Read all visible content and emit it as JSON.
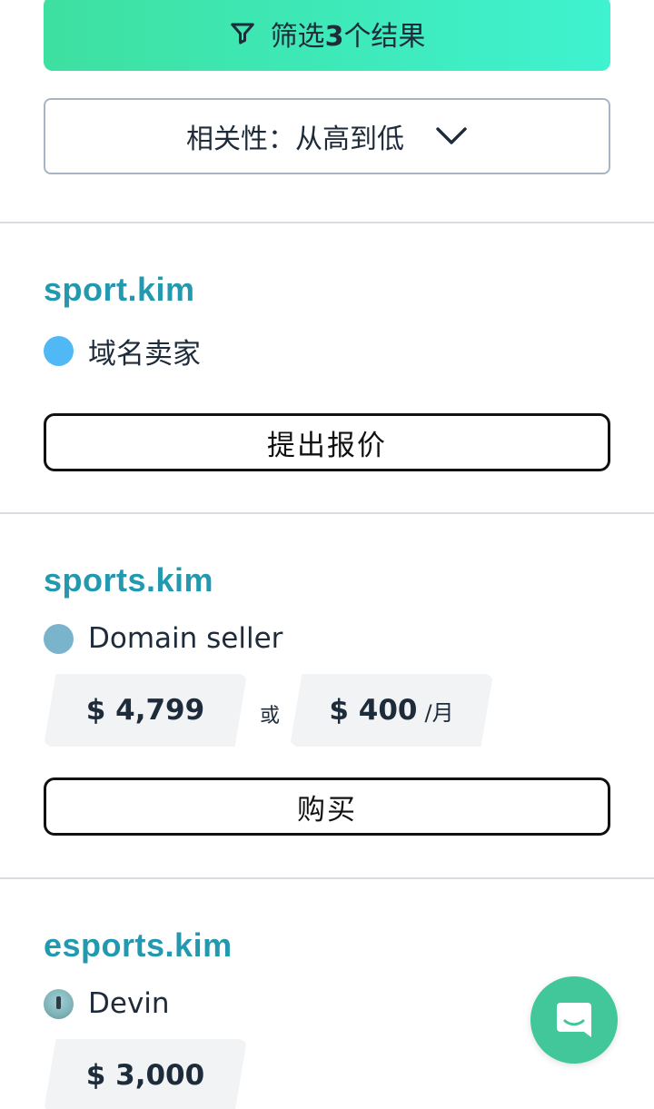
{
  "filter": {
    "prefix": "筛选",
    "count": "3",
    "suffix": "个结果",
    "icon": "filter-icon"
  },
  "sort": {
    "label": "相关性：从高到低",
    "icon": "chevron-down-icon"
  },
  "listings": [
    {
      "domain": "sport.kim",
      "seller": "域名卖家",
      "seller_dot_color": "#4fb8f5",
      "action": "提出报价"
    },
    {
      "domain": "sports.kim",
      "seller": "Domain seller",
      "seller_dot_color": "#7ab3cc",
      "price": "$ 4,799",
      "or": "或",
      "monthly_price": "$ 400",
      "monthly_unit": "/月",
      "action": "购买"
    },
    {
      "domain": "esports.kim",
      "seller": "Devin",
      "price": "$ 3,000"
    }
  ],
  "chat": {
    "icon": "chat-icon"
  },
  "colors": {
    "accent_gradient_start": "#3ee0a0",
    "accent_gradient_end": "#3ff2d0",
    "domain_link": "#2399b0",
    "chat_button": "#41c79a"
  }
}
